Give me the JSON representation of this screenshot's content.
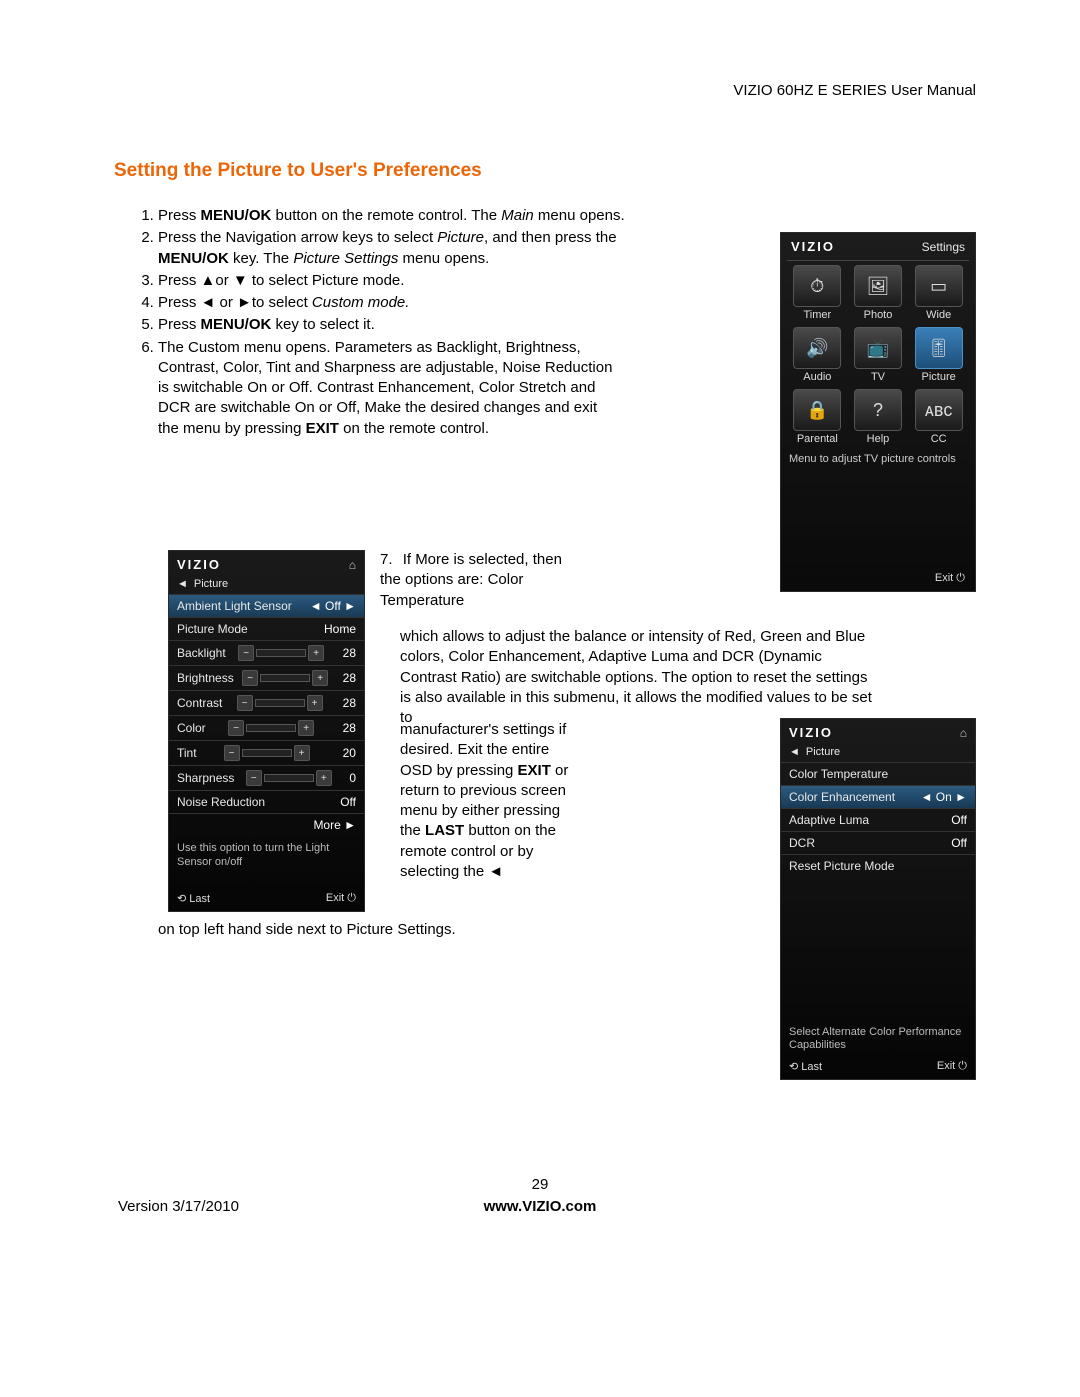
{
  "doc": {
    "header": "VIZIO 60HZ E SERIES User Manual",
    "title": "Setting the Picture to User's Preferences",
    "page_number": "29",
    "version": "Version 3/17/2010",
    "url": "www.VIZIO.com"
  },
  "steps": {
    "s1a": "Press ",
    "s1b": "MENU/OK",
    "s1c": " button on the remote control. The ",
    "s1d": "Main",
    "s1e": " menu opens.",
    "s2a": "Press the Navigation arrow keys to select ",
    "s2b": "Picture",
    "s2c": ", and then press the ",
    "s2d": "MENU/OK",
    "s2e": " key.  The ",
    "s2f": "Picture Settings",
    "s2g": " menu opens.",
    "s3": "Press ▲or ▼   to select Picture mode.",
    "s4a": "Press ◄ or ►to select ",
    "s4b": "Custom mode.",
    "s5a": "Press ",
    "s5b": "MENU/OK",
    "s5c": " key to select it.",
    "s6a": "The Custom menu opens. Parameters as Backlight, Brightness, Contrast, Color, Tint and Sharpness are adjustable, Noise Reduction is switchable On or Off. Contrast Enhancement, Color Stretch and DCR are switchable On or Off, Make the desired changes and exit the menu by pressing ",
    "s6b": "EXIT",
    "s6c": " on the remote control.",
    "s7num": "7.",
    "s7a": "If More is selected, then the options are: Color Temperature",
    "s7b": "which allows to adjust the balance or intensity of Red, Green and Blue colors, Color Enhancement, Adaptive Luma and DCR (Dynamic Contrast Ratio) are switchable options. The option to reset the settings is also available in this submenu, it allows the modified values to be set to",
    "s7c1": "manufacturer's settings if desired. Exit the entire OSD by pressing ",
    "s7c2": "EXIT",
    "s7c3": " or return to previous screen menu by either pressing the ",
    "s7c4": "LAST",
    "s7c5": " button on the remote control or by selecting the ◄",
    "tail": "on top left hand side next to Picture Settings."
  },
  "osd_settings": {
    "brand": "VIZIO",
    "title": "Settings",
    "hint": "Menu to adjust TV picture controls",
    "exit": "Exit ⏻",
    "cells": [
      {
        "icon": "⏱",
        "label": "Timer"
      },
      {
        "icon": "🖼",
        "label": "Photo"
      },
      {
        "icon": "▭",
        "label": "Wide"
      },
      {
        "icon": "🔊",
        "label": "Audio"
      },
      {
        "icon": "📺",
        "label": "TV"
      },
      {
        "icon": "🎚",
        "label": "Picture",
        "hl": true
      },
      {
        "icon": "🔒",
        "label": "Parental"
      },
      {
        "icon": "?",
        "label": "Help"
      },
      {
        "icon": "ᴀʙᴄ",
        "label": "CC"
      }
    ]
  },
  "osd_picture": {
    "brand": "VIZIO",
    "crumb_arrow": "◄",
    "crumb": "Picture",
    "rows": [
      {
        "name": "Ambient Light Sensor",
        "type": "toggle",
        "value": "◄ Off ►",
        "sel": true
      },
      {
        "name": "Picture Mode",
        "type": "text",
        "value": "Home"
      },
      {
        "name": "Backlight",
        "type": "slider",
        "value": "28"
      },
      {
        "name": "Brightness",
        "type": "slider",
        "value": "28"
      },
      {
        "name": "Contrast",
        "type": "slider",
        "value": "28"
      },
      {
        "name": "Color",
        "type": "slider",
        "value": "28"
      },
      {
        "name": "Tint",
        "type": "slider",
        "value": "20"
      },
      {
        "name": "Sharpness",
        "type": "slider",
        "value": "0"
      },
      {
        "name": "Noise Reduction",
        "type": "text",
        "value": "Off"
      },
      {
        "name": "",
        "type": "more",
        "value": "More   ►"
      }
    ],
    "hint": "Use this option to turn the Light Sensor on/off",
    "last": "⟲ Last",
    "exit": "Exit ⏻"
  },
  "osd_more": {
    "brand": "VIZIO",
    "crumb_arrow": "◄",
    "crumb": "Picture",
    "rows": [
      {
        "name": "Color Temperature",
        "value": ""
      },
      {
        "name": "Color Enhancement",
        "value": "◄ On ►",
        "sel": true
      },
      {
        "name": "Adaptive Luma",
        "value": "Off"
      },
      {
        "name": "DCR",
        "value": "Off"
      },
      {
        "name": "Reset Picture Mode",
        "value": ""
      }
    ],
    "hint": "Select Alternate Color Performance Capabilities",
    "last": "⟲ Last",
    "exit": "Exit ⏻"
  }
}
